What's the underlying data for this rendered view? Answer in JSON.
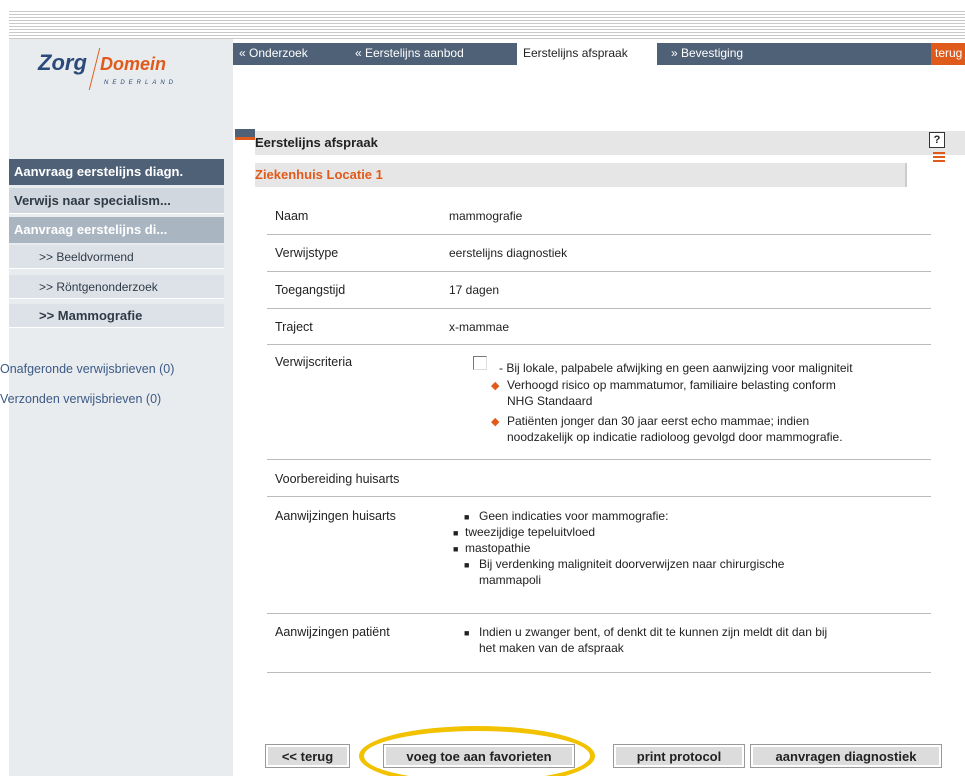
{
  "logo": {
    "zorg": "Zorg",
    "domein": "Domein",
    "nederland": "NEDERLAND"
  },
  "tabs": [
    {
      "label": "« Onderzoek"
    },
    {
      "label": "« Eerstelijns aanbod"
    },
    {
      "label": "Eerstelijns afspraak"
    },
    {
      "label": "» Bevestiging"
    }
  ],
  "tab_terug": "terug",
  "sidebar": {
    "header": "Aanvraag eerstelijns diagn.",
    "item1": "Verwijs naar specialism...",
    "item2": "Aanvraag eerstelijns di...",
    "sub1": ">> Beeldvormend",
    "sub2": ">> Röntgenonderzoek",
    "sub3": ">> Mammografie",
    "link1": "Onafgeronde verwijsbrieven (0)",
    "link2": "Verzonden verwijsbrieven (0)"
  },
  "panel": {
    "title": "Eerstelijns afspraak",
    "help": "?"
  },
  "section": {
    "title": "Ziekenhuis Locatie 1"
  },
  "details": {
    "naam_label": "Naam",
    "naam_value": "mammografie",
    "verwijstype_label": "Verwijstype",
    "verwijstype_value": "eerstelijns diagnostiek",
    "toegang_label": "Toegangstijd",
    "toegang_value": "17 dagen",
    "traject_label": "Traject",
    "traject_value": "x-mammae",
    "criteria_label": "Verwijscriteria",
    "criteria_main": "- Bij lokale, palpabele afwijking en geen aanwijzing voor maligniteit",
    "criteria_1a": "Verhoogd risico op mammatumor, familiaire belasting conform",
    "criteria_1b": "NHG Standaard",
    "criteria_2a": "Patiënten jonger dan 30 jaar eerst echo mammae; indien",
    "criteria_2b": "noodzakelijk op indicatie radioloog gevolgd door mammografie.",
    "voorbereiding_label": "Voorbereiding huisarts",
    "aanw_label": "Aanwijzingen huisarts",
    "aanw_1": "Geen indicaties voor mammografie:",
    "aanw_2": "tweezijdige tepeluitvloed",
    "aanw_3": "mastopathie",
    "aanw_4a": "Bij verdenking maligniteit doorverwijzen naar chirurgische",
    "aanw_4b": "mammapoli",
    "patient_label": "Aanwijzingen patiënt",
    "patient_1a": "Indien u zwanger bent, of denkt dit te kunnen zijn meldt dit dan bij",
    "patient_1b": "het maken van de afspraak"
  },
  "buttons": {
    "back": "<< terug",
    "favorite": "voeg toe aan favorieten",
    "print": "print protocol",
    "request": "aanvragen diagnostiek"
  },
  "colors": {
    "accent": "#e05a1b",
    "nav": "#4f6177",
    "highlight": "#f2c100"
  }
}
